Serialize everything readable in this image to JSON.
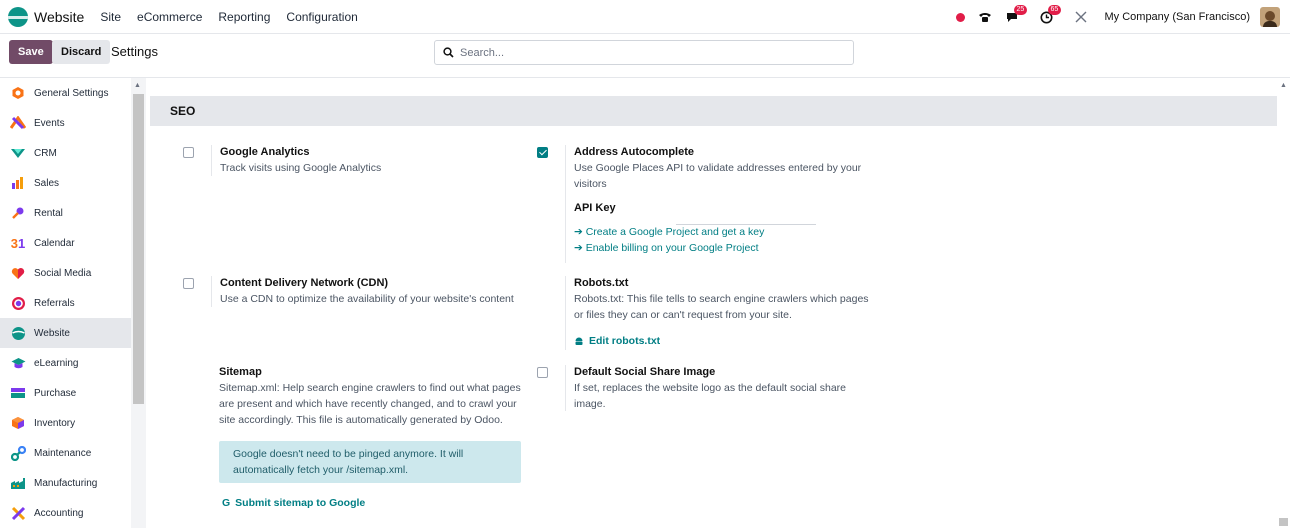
{
  "navbar": {
    "app_name": "Website",
    "menu": [
      "Site",
      "eCommerce",
      "Reporting",
      "Configuration"
    ],
    "messages_count": "25",
    "activities_count": "65",
    "company": "My Company (San Francisco)"
  },
  "control": {
    "save_label": "Save",
    "discard_label": "Discard",
    "title": "Settings",
    "search_placeholder": "Search..."
  },
  "sidebar": {
    "items": [
      {
        "label": "General Settings",
        "icon": "gear-hex-icon",
        "color": "#f97316"
      },
      {
        "label": "Events",
        "icon": "events-icon",
        "color": "#f97316"
      },
      {
        "label": "CRM",
        "icon": "crm-icon",
        "color": "#0d9488"
      },
      {
        "label": "Sales",
        "icon": "sales-chart-icon",
        "color": "#f97316"
      },
      {
        "label": "Rental",
        "icon": "key-icon",
        "color": "#7c3aed"
      },
      {
        "label": "Calendar",
        "icon": "calendar-icon",
        "color": "#f97316"
      },
      {
        "label": "Social Media",
        "icon": "heart-icon",
        "color": "#f97316"
      },
      {
        "label": "Referrals",
        "icon": "referrals-icon",
        "color": "#e11d48"
      },
      {
        "label": "Website",
        "icon": "globe-icon",
        "color": "#0d9488"
      },
      {
        "label": "eLearning",
        "icon": "graduation-icon",
        "color": "#0d9488"
      },
      {
        "label": "Purchase",
        "icon": "purchase-icon",
        "color": "#7c3aed"
      },
      {
        "label": "Inventory",
        "icon": "box-icon",
        "color": "#f97316"
      },
      {
        "label": "Maintenance",
        "icon": "wrench-icon",
        "color": "#3b82f6"
      },
      {
        "label": "Manufacturing",
        "icon": "factory-icon",
        "color": "#0d9488"
      },
      {
        "label": "Accounting",
        "icon": "accounting-icon",
        "color": "#f59e0b"
      }
    ],
    "active_index": 8
  },
  "seo": {
    "heading": "SEO",
    "google_analytics": {
      "title": "Google Analytics",
      "desc": "Track visits using Google Analytics",
      "checked": false
    },
    "address_autocomplete": {
      "title": "Address Autocomplete",
      "desc": "Use Google Places API to validate addresses entered by your visitors",
      "checked": true,
      "api_key_label": "API Key",
      "link1": "➔ Create a Google Project and get a key",
      "link2": "➔ Enable billing on your Google Project"
    },
    "cdn": {
      "title": "Content Delivery Network (CDN)",
      "desc": "Use a CDN to optimize the availability of your website's content",
      "checked": false
    },
    "robots": {
      "title": "Robots.txt",
      "desc": "Robots.txt: This file tells to search engine crawlers which pages or files they can or can't request from your site.",
      "link": "Edit robots.txt"
    },
    "sitemap": {
      "title": "Sitemap",
      "desc": "Sitemap.xml: Help search engine crawlers to find out what pages are present and which have recently changed, and to crawl your site accordingly. This file is automatically generated by Odoo.",
      "alert": "Google doesn't need to be pinged anymore. It will automatically fetch your /sitemap.xml.",
      "link": "Submit sitemap to Google"
    },
    "social_share": {
      "title": "Default Social Share Image",
      "desc": "If set, replaces the website logo as the default social share image.",
      "checked": false
    }
  }
}
